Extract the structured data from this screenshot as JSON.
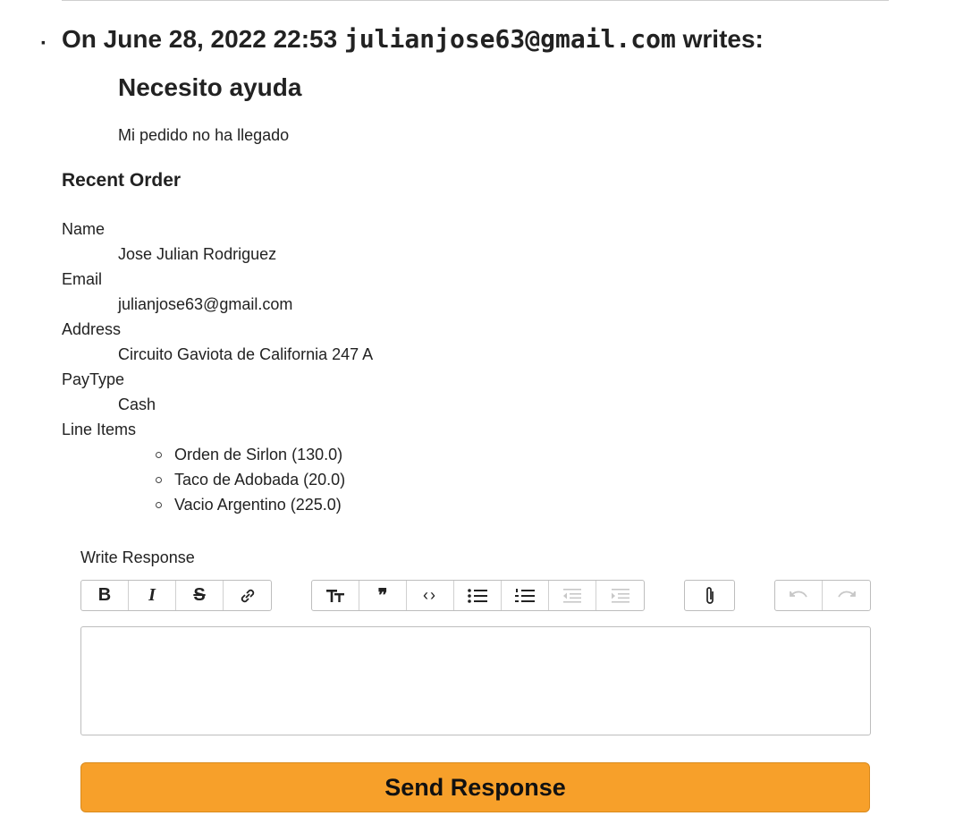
{
  "message": {
    "prefix": "On June 28, 2022 22:53",
    "author": "julianjose63@gmail.com",
    "suffix": "writes:",
    "title": "Necesito ayuda",
    "body": "Mi pedido no ha llegado"
  },
  "order": {
    "title": "Recent Order",
    "fields": [
      {
        "label": "Name",
        "value": "Jose Julian Rodriguez"
      },
      {
        "label": "Email",
        "value": "julianjose63@gmail.com"
      },
      {
        "label": "Address",
        "value": "Circuito Gaviota de California 247 A"
      },
      {
        "label": "PayType",
        "value": "Cash"
      }
    ],
    "line_items_label": "Line Items",
    "line_items": [
      "Orden de Sirlon (130.0)",
      "Taco de Adobada (20.0)",
      "Vacio Argentino (225.0)"
    ]
  },
  "response": {
    "label": "Write Response",
    "editor_value": "",
    "send_label": "Send Response"
  },
  "toolbar": {
    "text_format": [
      "bold-icon",
      "italic-icon",
      "strikethrough-icon",
      "link-icon"
    ],
    "block_format": [
      "heading-icon",
      "quote-icon",
      "code-icon",
      "bullet-list-icon",
      "numbered-list-icon",
      "outdent-icon",
      "indent-icon"
    ],
    "files": [
      "attach-icon"
    ],
    "history": [
      "undo-icon",
      "redo-icon"
    ],
    "bold_glyph": "B",
    "italic_glyph": "I",
    "strike_glyph": "S",
    "quote_glyph": "❞",
    "code_glyph": "‹›"
  },
  "colors": {
    "accent": "#f7a02a",
    "text": "#222222",
    "border": "#bdbdbd"
  }
}
